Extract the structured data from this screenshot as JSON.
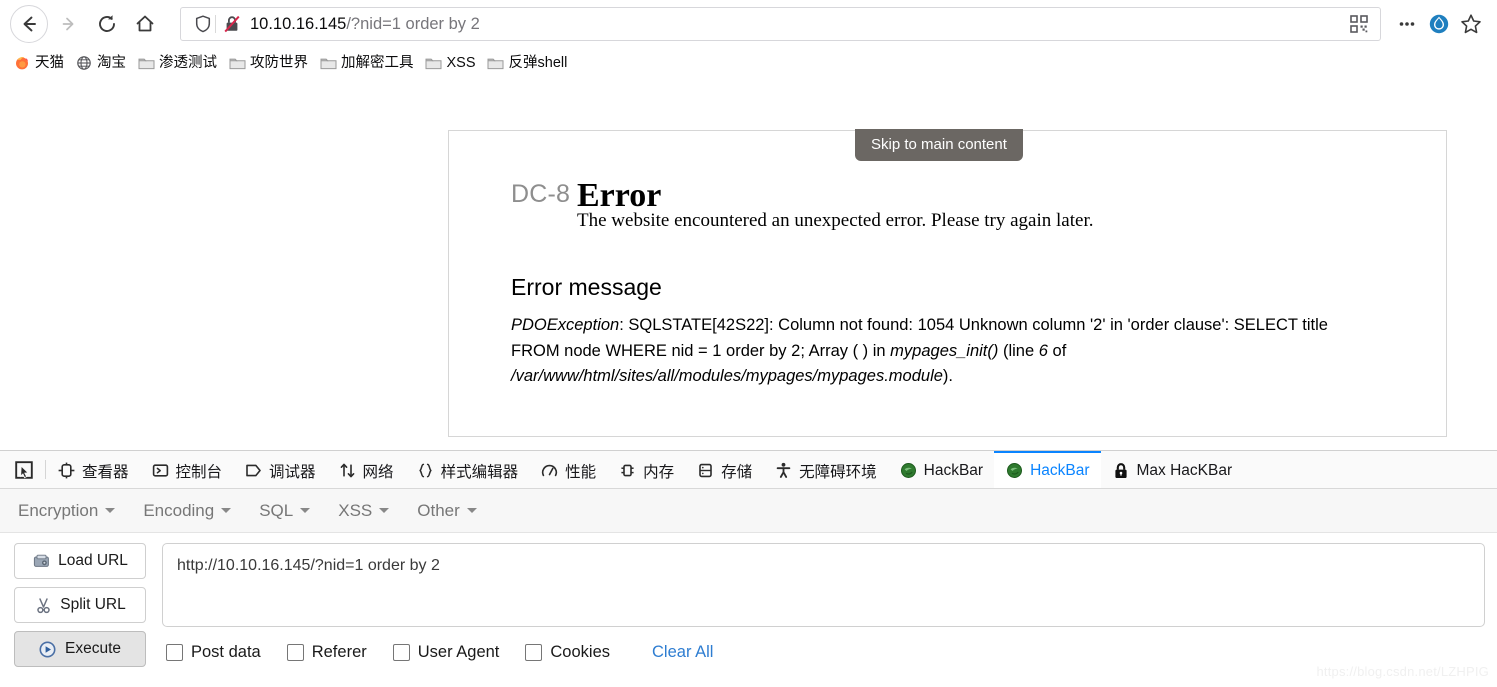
{
  "browser": {
    "nav": {
      "back_icon": "arrow-left-icon",
      "forward_icon": "arrow-right-icon",
      "reload_icon": "reload-icon",
      "home_icon": "home-icon"
    },
    "urlbar": {
      "shield_icon": "shield-icon",
      "insecure_icon": "crossed-padlock-icon",
      "host": "10.10.16.145",
      "path": "/?nid=1 order by 2",
      "qr_icon": "qr-code-icon",
      "more_icon": "ellipsis-icon",
      "drupal_icon": "drupal-drop-icon",
      "bookmark_icon": "star-icon"
    },
    "bookmarks": [
      {
        "label": "天猫",
        "icon": "firefox-icon"
      },
      {
        "label": "淘宝",
        "icon": "globe-icon"
      },
      {
        "label": "渗透测试",
        "icon": "folder-icon"
      },
      {
        "label": "攻防世界",
        "icon": "folder-icon"
      },
      {
        "label": "加解密工具",
        "icon": "folder-icon"
      },
      {
        "label": "XSS",
        "icon": "folder-icon"
      },
      {
        "label": "反弹shell",
        "icon": "folder-icon"
      }
    ]
  },
  "page": {
    "skip_link": "Skip to main content",
    "site_name": "DC-8",
    "title": "Error",
    "lede": "The website encountered an unexpected error. Please try again later.",
    "error_heading": "Error message",
    "error_parts": {
      "exception": "PDOException",
      "rest1": ": SQLSTATE[42S22]: Column not found: 1054 Unknown column '2' in 'order clause': SELECT title FROM node WHERE nid = 1 order by 2; Array ( ) in ",
      "function": "mypages_init()",
      "rest2": " (line ",
      "line": "6",
      "rest3": " of ",
      "file": "/var/www/html/sites/all/modules/mypages/mypages.module",
      "rest4": ")."
    }
  },
  "devtools": {
    "picker_icon": "element-picker-icon",
    "tabs": [
      {
        "label": "查看器",
        "icon": "inspector-icon",
        "active": false
      },
      {
        "label": "控制台",
        "icon": "console-icon",
        "active": false
      },
      {
        "label": "调试器",
        "icon": "debugger-icon",
        "active": false
      },
      {
        "label": "网络",
        "icon": "network-arrows-icon",
        "active": false
      },
      {
        "label": "样式编辑器",
        "icon": "braces-icon",
        "active": false
      },
      {
        "label": "性能",
        "icon": "gauge-icon",
        "active": false
      },
      {
        "label": "内存",
        "icon": "memory-icon",
        "active": false
      },
      {
        "label": "存储",
        "icon": "storage-icon",
        "active": false
      },
      {
        "label": "无障碍环境",
        "icon": "accessibility-person-icon",
        "active": false
      },
      {
        "label": "HackBar",
        "icon": "hackbar-green-icon",
        "active": false
      },
      {
        "label": "HackBar",
        "icon": "hackbar-green-icon",
        "active": true
      },
      {
        "label": "Max HacKBar",
        "icon": "padlock-icon",
        "active": false
      }
    ]
  },
  "hackbar": {
    "menus": [
      {
        "label": "Encryption"
      },
      {
        "label": "Encoding"
      },
      {
        "label": "SQL"
      },
      {
        "label": "XSS"
      },
      {
        "label": "Other"
      }
    ],
    "buttons": [
      {
        "label": "Load URL",
        "icon": "load-url-icon",
        "primary": false
      },
      {
        "label": "Split URL",
        "icon": "scissors-icon",
        "primary": false
      },
      {
        "label": "Execute",
        "icon": "play-icon",
        "primary": true
      }
    ],
    "url_value": "http://10.10.16.145/?nid=1 order by 2",
    "options": [
      {
        "label": "Post data",
        "checked": false
      },
      {
        "label": "Referer",
        "checked": false
      },
      {
        "label": "User Agent",
        "checked": false
      },
      {
        "label": "Cookies",
        "checked": false
      }
    ],
    "clear_all": "Clear All"
  },
  "watermark": "https://blog.csdn.net/LZHPIG",
  "colors": {
    "accent": "#0a84ff",
    "link": "#2e7dd1",
    "skip_bg": "#6b6763",
    "site_name": "#8e8e8e"
  }
}
